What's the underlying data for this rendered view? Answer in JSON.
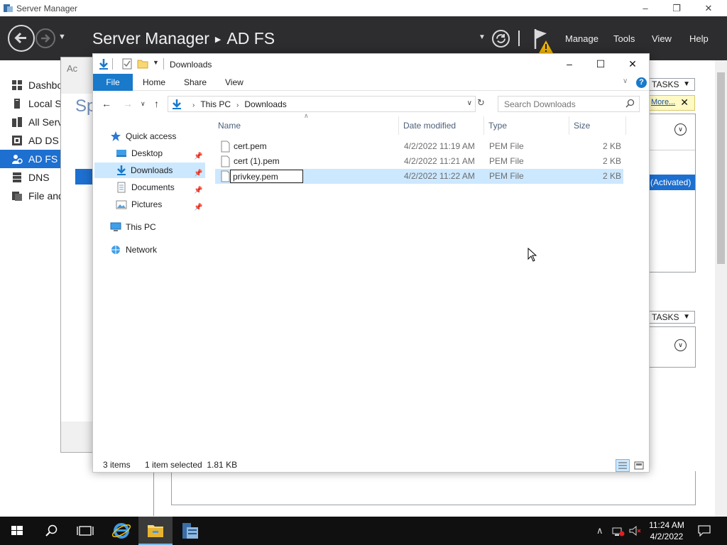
{
  "server_manager": {
    "window_title": "Server Manager",
    "breadcrumb_root": "Server Manager",
    "breadcrumb_current": "AD FS",
    "menu": [
      "Manage",
      "Tools",
      "View",
      "Help"
    ],
    "nav": [
      {
        "label": "Dashboard",
        "icon": "dashboard-icon"
      },
      {
        "label": "Local Server",
        "icon": "local-server-icon"
      },
      {
        "label": "All Servers",
        "icon": "all-servers-icon"
      },
      {
        "label": "AD DS",
        "icon": "ad-ds-icon"
      },
      {
        "label": "AD FS",
        "icon": "ad-fs-icon",
        "active": true
      },
      {
        "label": "DNS",
        "icon": "dns-icon"
      },
      {
        "label": "File and Storage Services",
        "icon": "file-storage-icon"
      }
    ],
    "tasks_label": "TASKS",
    "more_link": "More...",
    "activated_text": "(Activated)",
    "dialog_title_partial": "Ac",
    "dialog_heading_partial": "Sp"
  },
  "explorer": {
    "window_title": "Downloads",
    "ribbon_tabs": [
      "File",
      "Home",
      "Share",
      "View"
    ],
    "address": {
      "root": "This PC",
      "current": "Downloads"
    },
    "search_placeholder": "Search Downloads",
    "nav": {
      "quick_access": "Quick access",
      "desktop": "Desktop",
      "downloads": "Downloads",
      "documents": "Documents",
      "pictures": "Pictures",
      "this_pc": "This PC",
      "network": "Network"
    },
    "columns": {
      "name": "Name",
      "date": "Date modified",
      "type": "Type",
      "size": "Size"
    },
    "files": [
      {
        "name": "cert.pem",
        "date": "4/2/2022 11:19 AM",
        "type": "PEM File",
        "size": "2 KB"
      },
      {
        "name": "cert (1).pem",
        "date": "4/2/2022 11:21 AM",
        "type": "PEM File",
        "size": "2 KB"
      },
      {
        "name": "privkey.pem",
        "date": "4/2/2022 11:22 AM",
        "type": "PEM File",
        "size": "2 KB",
        "renaming": true
      }
    ],
    "status": {
      "items": "3 items",
      "selected": "1 item selected  1.81 KB"
    }
  },
  "taskbar": {
    "time": "11:24 AM",
    "date": "4/2/2022"
  },
  "colors": {
    "accent": "#1979ca",
    "selection": "#cce8ff",
    "sm_header": "#2d2d30",
    "sm_active_nav": "#1d6fd0",
    "taskbar": "#101010"
  }
}
